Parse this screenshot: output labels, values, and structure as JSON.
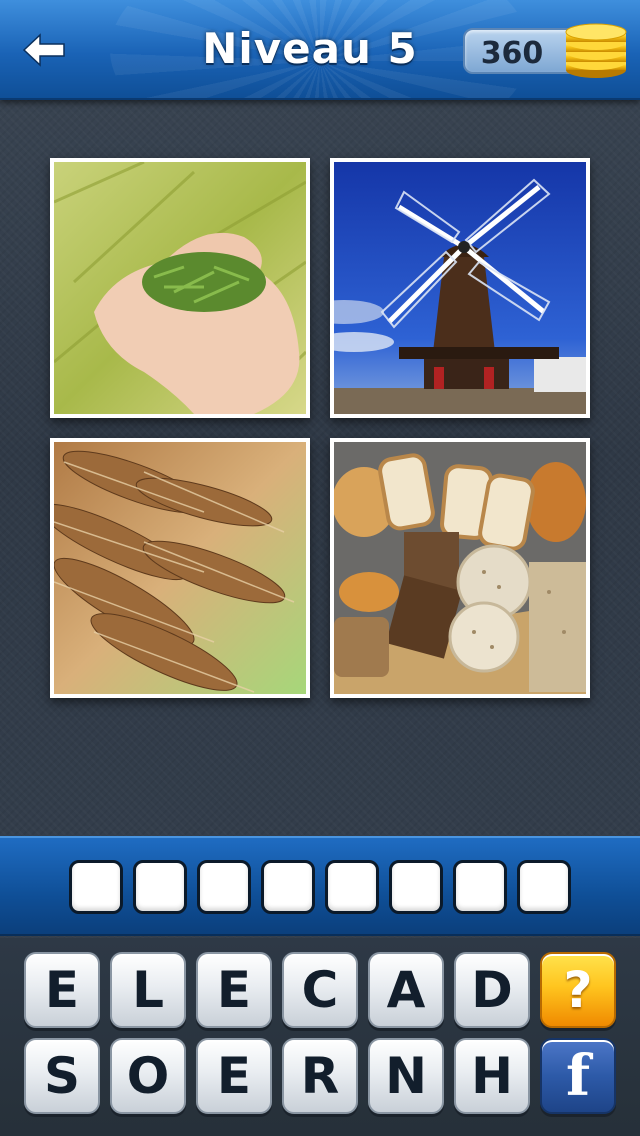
{
  "header": {
    "title": "Niveau 5",
    "coins": "360"
  },
  "images": [
    {
      "subject": "hands-holding-grain"
    },
    {
      "subject": "windmill"
    },
    {
      "subject": "wheat-ears"
    },
    {
      "subject": "bread-assortment"
    }
  ],
  "answer_slots": [
    "",
    "",
    "",
    "",
    "",
    "",
    "",
    ""
  ],
  "keyboard": {
    "row1": [
      "E",
      "L",
      "E",
      "C",
      "A",
      "D"
    ],
    "row2": [
      "S",
      "O",
      "E",
      "R",
      "N",
      "H"
    ],
    "help_label": "?",
    "facebook_label": "f"
  },
  "colors": {
    "header_blue": "#1a63b6",
    "help_orange": "#ffc51f",
    "facebook_blue": "#2d5aa8"
  }
}
